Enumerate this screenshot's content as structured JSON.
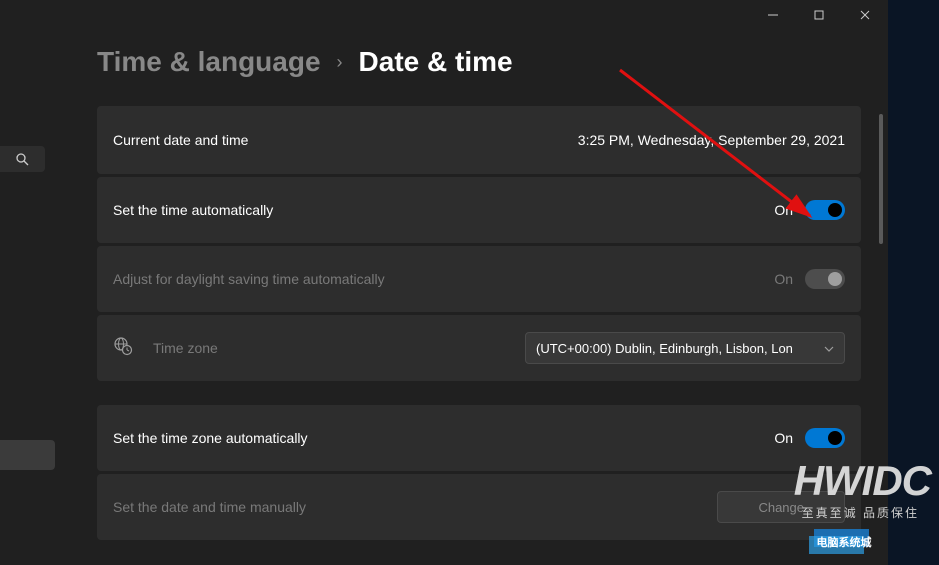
{
  "breadcrumb": {
    "parent": "Time & language",
    "sep": "›",
    "current": "Date & time"
  },
  "rows": {
    "current": {
      "label": "Current date and time",
      "value": "3:25 PM, Wednesday, September 29, 2021"
    },
    "autoTime": {
      "label": "Set the time automatically",
      "state": "On"
    },
    "dst": {
      "label": "Adjust for daylight saving time automatically",
      "state": "On"
    },
    "tz": {
      "label": "Time zone",
      "value": "(UTC+00:00) Dublin, Edinburgh, Lisbon, Lon"
    },
    "autoTz": {
      "label": "Set the time zone automatically",
      "state": "On"
    },
    "manual": {
      "label": "Set the date and time manually",
      "button": "Change"
    }
  },
  "watermark": {
    "brand": "HWIDC",
    "tagline": "至真至诚 品质保住"
  }
}
